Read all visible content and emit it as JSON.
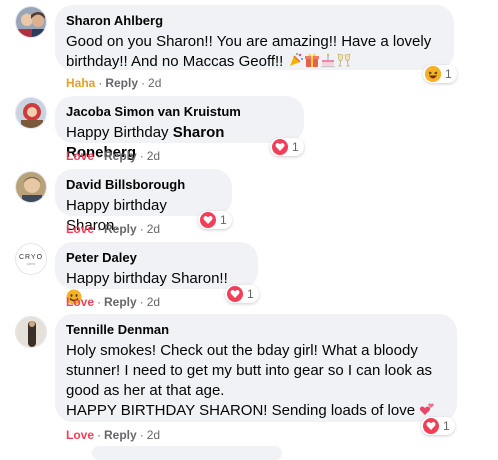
{
  "comments": [
    {
      "author": "Sharon Ahlberg",
      "text_line1": "Good on you Sharon!! You are amazing!! Have a lovely",
      "text_line2": "birthday!! And no Maccas Geoff!!",
      "emojis": [
        "party-popper",
        "gift",
        "birthday-cake",
        "clinking-glasses"
      ],
      "reaction": "Haha",
      "reply": "Reply",
      "time": "2d",
      "reaction_icon": "haha",
      "reaction_count": "1"
    },
    {
      "author": "Jacoba Simon van Kruistum",
      "text": "Happy Birthday ",
      "mention": "Sharon Roneberg",
      "reaction": "Love",
      "reply": "Reply",
      "time": "2d",
      "reaction_icon": "love",
      "reaction_count": "1"
    },
    {
      "author": "David Billsborough",
      "text": "Happy birthday Sharon.",
      "reaction": "Love",
      "reply": "Reply",
      "time": "2d",
      "reaction_icon": "love",
      "reaction_count": "1"
    },
    {
      "author": "Peter Daley",
      "avatar_text": "CRYO",
      "avatar_subtext": "CRYO",
      "text": "Happy birthday Sharon!!",
      "emojis": [
        "smiling-face"
      ],
      "reaction": "Love",
      "reply": "Reply",
      "time": "2d",
      "reaction_icon": "love",
      "reaction_count": "1"
    },
    {
      "author": "Tennille Denman",
      "text_line1": "Holy smokes! Check out the bday girl! What a bloody",
      "text_line2": "stunner! I need to get my butt into gear so I can look as",
      "text_line3": "good as her at that age.",
      "text_line4": "HAPPY BIRTHDAY SHARON! Sending loads of love",
      "emojis": [
        "two-hearts"
      ],
      "reaction": "Love",
      "reply": "Reply",
      "time": "2d",
      "reaction_icon": "love",
      "reaction_count": "1"
    }
  ],
  "colors": {
    "bubble": "#f0f2f5",
    "love": "#f33e58",
    "haha": "#e8a01e",
    "meta": "#65676b"
  }
}
